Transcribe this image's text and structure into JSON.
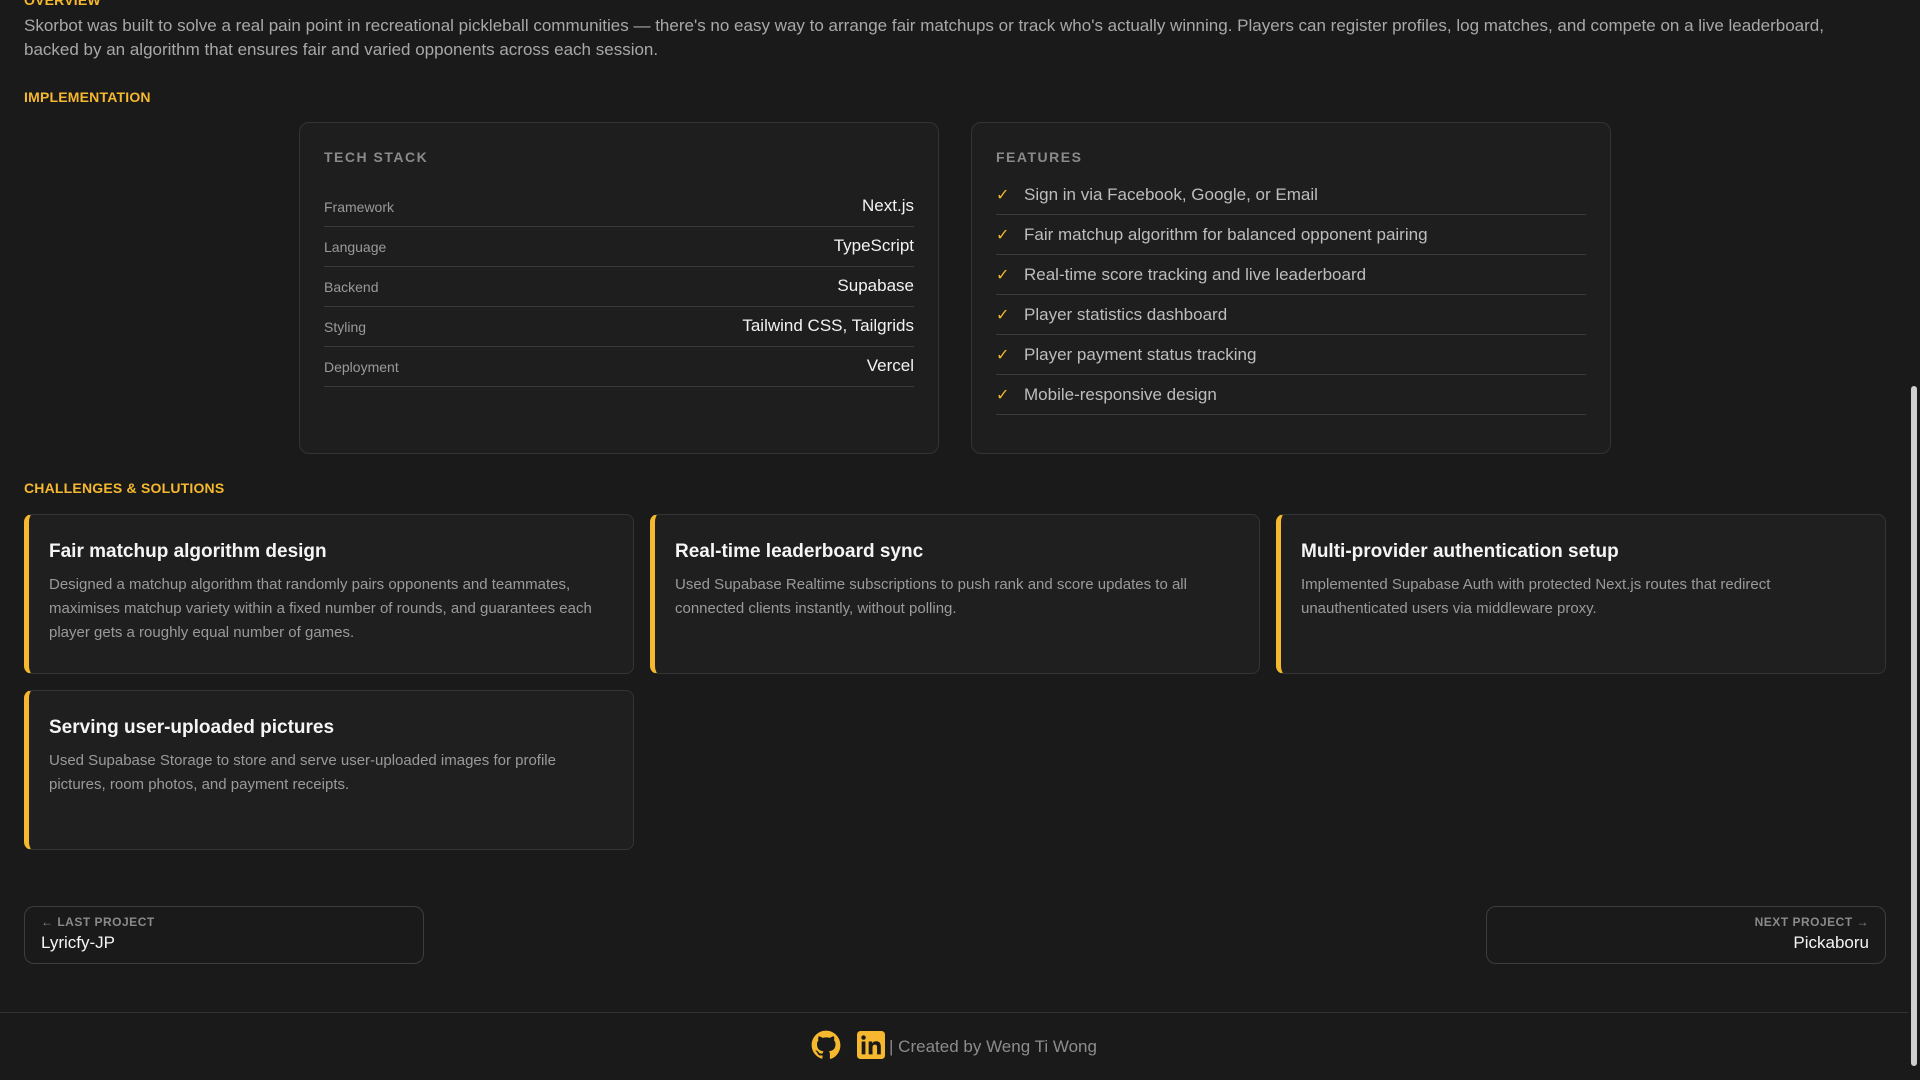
{
  "overview": {
    "label": "OVERVIEW",
    "text": "Skorbot was built to solve a real pain point in recreational pickleball communities — there's no easy way to arrange fair matchups or track who's actually winning. Players can register profiles, log matches, and compete on a live leaderboard, backed by an algorithm that ensures fair and varied opponents across each session."
  },
  "implementation": {
    "label": "IMPLEMENTATION",
    "tech_stack": {
      "title": "TECH STACK",
      "rows": [
        {
          "key": "Framework",
          "value": "Next.js"
        },
        {
          "key": "Language",
          "value": "TypeScript"
        },
        {
          "key": "Backend",
          "value": "Supabase"
        },
        {
          "key": "Styling",
          "value": "Tailwind CSS, Tailgrids"
        },
        {
          "key": "Deployment",
          "value": "Vercel"
        }
      ]
    },
    "features": {
      "title": "FEATURES",
      "items": [
        "Sign in via Facebook, Google, or Email",
        "Fair matchup algorithm for balanced opponent pairing",
        "Real-time score tracking and live leaderboard",
        "Player statistics dashboard",
        "Player payment status tracking",
        "Mobile-responsive design"
      ]
    }
  },
  "challenges": {
    "label": "CHALLENGES & SOLUTIONS",
    "cards": [
      {
        "title": "Fair matchup algorithm design",
        "desc": "Designed a matchup algorithm that randomly pairs opponents and teammates, maximises matchup variety within a fixed number of rounds, and guarantees each player gets a roughly equal number of games."
      },
      {
        "title": "Real-time leaderboard sync",
        "desc": "Used Supabase Realtime subscriptions to push rank and score updates to all connected clients instantly, without polling."
      },
      {
        "title": "Multi-provider authentication setup",
        "desc": "Implemented Supabase Auth with protected Next.js routes that redirect unauthenticated users via middleware proxy."
      },
      {
        "title": "Serving user-uploaded pictures",
        "desc": "Used Supabase Storage to store and serve user-uploaded images for profile pictures, room photos, and payment receipts."
      }
    ]
  },
  "navigation": {
    "prev_label": "LAST PROJECT",
    "prev_title": "Lyricfy-JP",
    "next_label": "NEXT PROJECT",
    "next_title": "Pickaboru"
  },
  "footer": {
    "text": "| Created by Weng Ti Wong",
    "icons": [
      "github-icon",
      "linkedin-icon"
    ]
  },
  "colors": {
    "accent": "#f5b82e",
    "background": "#1a1a1a"
  }
}
